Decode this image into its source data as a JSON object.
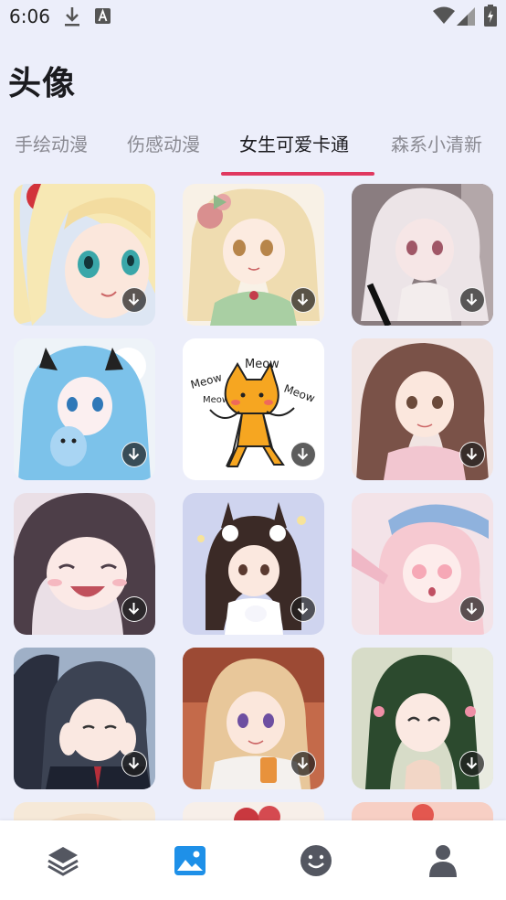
{
  "status_bar": {
    "time": "6:06",
    "icons": [
      "download-icon",
      "a-icon",
      "wifi-icon",
      "signal-icon",
      "battery-icon"
    ]
  },
  "header": {
    "title": "头像"
  },
  "tabs": [
    {
      "label": "手绘动漫",
      "active": false
    },
    {
      "label": "伤感动漫",
      "active": false
    },
    {
      "label": "女生可爱卡通",
      "active": true
    },
    {
      "label": "森系小清新",
      "active": false
    }
  ],
  "accent_color": "#e0385f",
  "grid": {
    "tiles": [
      {
        "name": "anime-blonde-girl",
        "download_icon": "download-icon"
      },
      {
        "name": "anime-girl-flower-bow",
        "download_icon": "download-icon"
      },
      {
        "name": "anime-white-hair-girl",
        "download_icon": "download-icon"
      },
      {
        "name": "anime-blue-hair-cat-ears",
        "download_icon": "download-icon"
      },
      {
        "name": "cartoon-meow-cat",
        "download_icon": "download-icon",
        "text": [
          "Meow",
          "Meow",
          "Meow",
          "Meow"
        ]
      },
      {
        "name": "anime-brunette-girl",
        "download_icon": "download-icon"
      },
      {
        "name": "anime-laughing-girl",
        "download_icon": "download-icon"
      },
      {
        "name": "anime-bunny-ears-girl",
        "download_icon": "download-icon"
      },
      {
        "name": "anime-pink-hair-salute",
        "download_icon": "download-icon"
      },
      {
        "name": "anime-dark-hair-blush",
        "download_icon": "download-icon"
      },
      {
        "name": "anime-blonde-autumn",
        "download_icon": "download-icon"
      },
      {
        "name": "anime-green-hair-girl",
        "download_icon": "download-icon"
      }
    ]
  },
  "bottom_nav": [
    {
      "icon": "layers-icon",
      "active": false
    },
    {
      "icon": "image-icon",
      "active": true
    },
    {
      "icon": "smiley-icon",
      "active": false
    },
    {
      "icon": "profile-icon",
      "active": false
    }
  ]
}
